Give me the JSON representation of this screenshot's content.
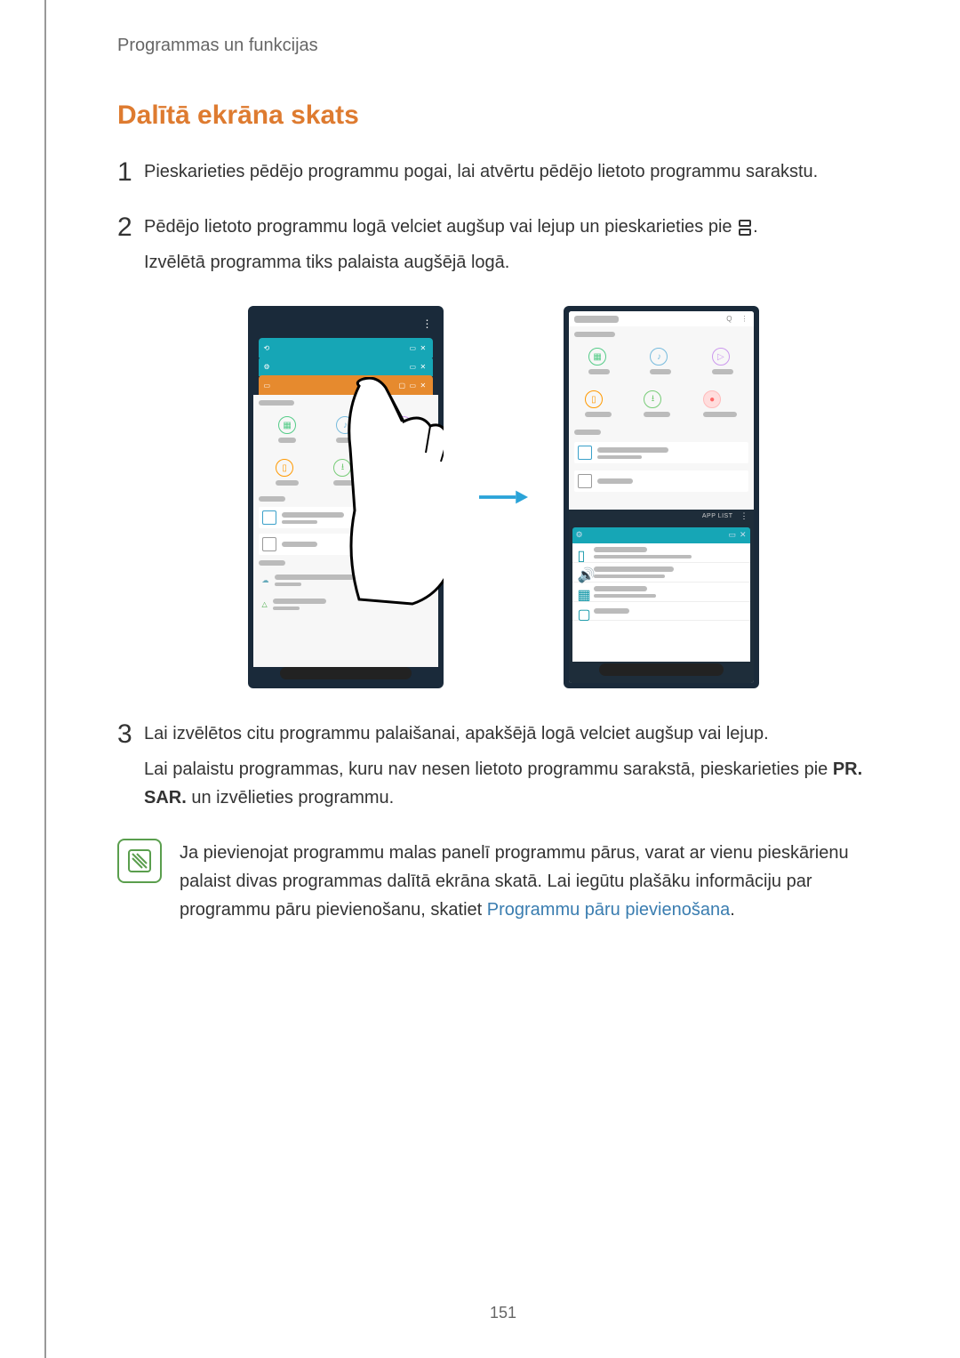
{
  "header": {
    "section": "Programmas un funkcijas"
  },
  "title": "Dalītā ekrāna skats",
  "steps": [
    {
      "num": "1",
      "text": "Pieskarieties pēdējo programmu pogai, lai atvērtu pēdējo lietoto programmu sarakstu."
    },
    {
      "num": "2",
      "text_a": "Pēdējo lietoto programmu logā velciet augšup vai lejup un pieskarieties pie ",
      "text_b": ".",
      "text_c": "Izvēlētā programma tiks palaista augšējā logā."
    },
    {
      "num": "3",
      "text_a": "Lai izvēlētos citu programmu palaišanai, apakšējā logā velciet augšup vai lejup.",
      "text_b": "Lai palaistu programmas, kuru nav nesen lietoto programmu sarakstā, pieskarieties pie ",
      "bold": "PR. SAR.",
      "text_c": " un izvēlieties programmu."
    }
  ],
  "note": {
    "text_a": "Ja pievienojat programmu malas panelī programmu pārus, varat ar vienu pieskārienu palaist divas programmas dalītā ekrāna skatā. Lai iegūtu plašāku informāciju par programmu pāru pievienošanu, skatiet ",
    "link": "Programmu pāru pievienošana",
    "text_b": "."
  },
  "page_number": "151",
  "figure": {
    "phone1_recents": [
      "#16a6b6",
      "#16a6b6",
      "#e68a2e"
    ],
    "app_list_placeholder": "APP LIST",
    "search_icon": "Q",
    "more_icon": "⋮"
  }
}
